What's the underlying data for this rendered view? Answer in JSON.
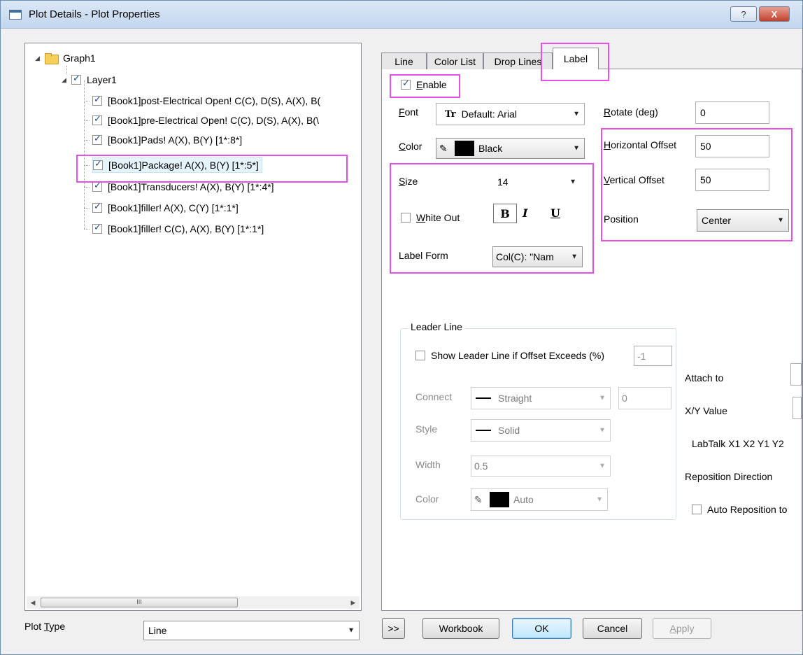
{
  "window": {
    "title": "Plot Details - Plot Properties",
    "help_label": "?",
    "close_label": "X"
  },
  "tree": {
    "root": "Graph1",
    "layer": "Layer1",
    "items": [
      "[Book1]post-Electrical Open! C(C), D(S), A(X), B(",
      "[Book1]pre-Electrical Open! C(C), D(S), A(X), B(\\",
      "[Book1]Pads! A(X), B(Y) [1*:8*]",
      "[Book1]Package! A(X), B(Y) [1*:5*]",
      "[Book1]Transducers! A(X), B(Y) [1*:4*]",
      "[Book1]filler! A(X), C(Y) [1*:1*]",
      "[Book1]filler! C(C), A(X), B(Y) [1*:1*]"
    ],
    "scroll_thumb_glyph": "III"
  },
  "plot_type": {
    "label_pre": "Plot ",
    "label_key": "T",
    "label_post": "ype",
    "value": "Line"
  },
  "tabs": [
    "Line",
    "Color List",
    "Drop Lines",
    "Label"
  ],
  "label_tab": {
    "enable": {
      "key": "E",
      "rest": "nable",
      "checked": true
    },
    "font": {
      "label_key": "F",
      "label_rest": "ont",
      "icon": "Tr",
      "value": "Default: Arial"
    },
    "color": {
      "label_key": "C",
      "label_rest": "olor",
      "value": "Black",
      "swatch": "#000000"
    },
    "size": {
      "label_key": "S",
      "label_rest": "ize",
      "value": "14"
    },
    "white_out": {
      "key": "W",
      "rest": "hite Out",
      "checked": false
    },
    "format_buttons": {
      "bold": "B",
      "italic": "I",
      "underline": "U"
    },
    "label_form": {
      "label": "Label Form",
      "value": "Col(C): \"Nam"
    },
    "rotate": {
      "label_key": "R",
      "label_rest": "otate (deg)",
      "value": "0"
    },
    "horizontal_offset": {
      "label_key": "H",
      "label_rest": "orizontal Offset",
      "value": "50"
    },
    "vertical_offset": {
      "label_key": "V",
      "label_rest": "ertical Offset",
      "value": "50"
    },
    "position": {
      "label": "Position",
      "value": "Center"
    }
  },
  "leader_line": {
    "title": "Leader Line",
    "show_label": "Show Leader Line if Offset Exceeds (%)",
    "show_value": "-1",
    "connect_label": "Connect",
    "connect_value": "Straight",
    "connect_num": "0",
    "style_label": "Style",
    "style_value": "Solid",
    "width_label": "Width",
    "width_value": "0.5",
    "color_label": "Color",
    "color_value": "Auto"
  },
  "attach": {
    "attach_to": "Attach to",
    "xy_value": "X/Y Value",
    "labtalk": "LabTalk X1 X2 Y1 Y2",
    "reposition_direction": "Reposition Direction",
    "auto_reposition": "Auto Reposition to"
  },
  "buttons": {
    "expand": ">>",
    "workbook": "Workbook",
    "ok": "OK",
    "cancel": "Cancel",
    "apply_key": "A",
    "apply_rest": "pply"
  },
  "colors": {
    "highlight": "#e84fe8",
    "accent": "#3c7fb1"
  }
}
